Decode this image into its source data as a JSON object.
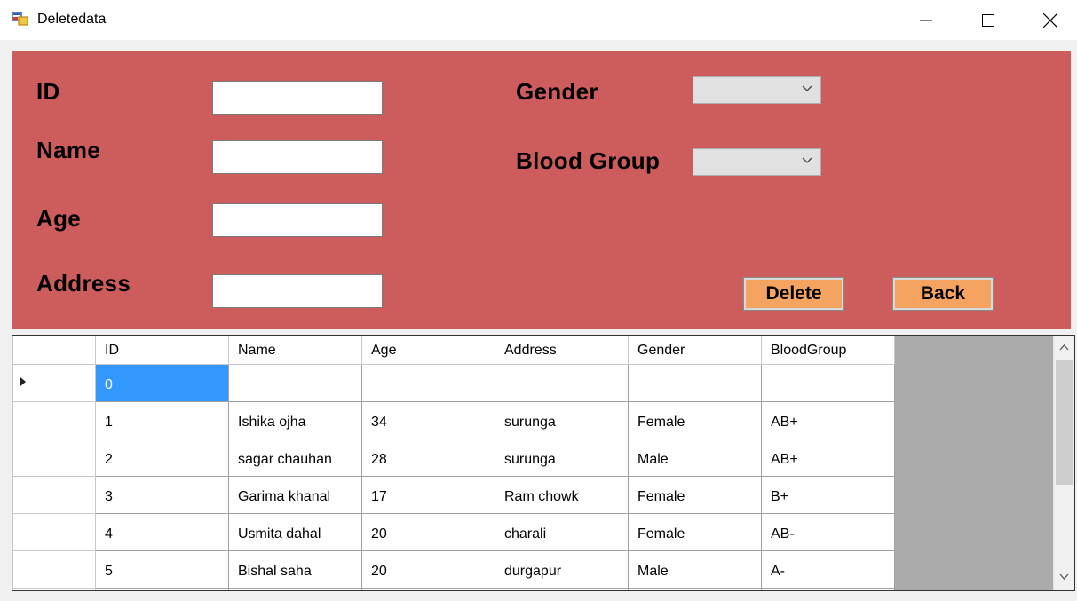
{
  "window": {
    "title": "Deletedata"
  },
  "form": {
    "id_label": "ID",
    "name_label": "Name",
    "age_label": "Age",
    "address_label": "Address",
    "gender_label": "Gender",
    "blood_group_label": "Blood Group",
    "id_value": "",
    "name_value": "",
    "age_value": "",
    "address_value": "",
    "gender_value": "",
    "blood_group_value": "",
    "delete_label": "Delete",
    "back_label": "Back"
  },
  "colors": {
    "panel": "#cd5c5c",
    "button": "#f4a460",
    "selected_cell": "#3399ff"
  },
  "grid": {
    "columns": [
      "ID",
      "Name",
      "Age",
      "Address",
      "Gender",
      "BloodGroup"
    ],
    "rows": [
      [
        "0",
        "",
        "",
        "",
        "",
        ""
      ],
      [
        "1",
        "Ishika ojha",
        "34",
        "surunga",
        "Female",
        "AB+"
      ],
      [
        "2",
        "sagar chauhan",
        "28",
        "surunga",
        "Male",
        "AB+"
      ],
      [
        "3",
        "Garima khanal",
        "17",
        "Ram chowk",
        "Female",
        "B+"
      ],
      [
        "4",
        "Usmita dahal",
        "20",
        "charali",
        "Female",
        "AB-"
      ],
      [
        "5",
        "Bishal saha",
        "20",
        "durgapur",
        "Male",
        "A-"
      ]
    ]
  }
}
